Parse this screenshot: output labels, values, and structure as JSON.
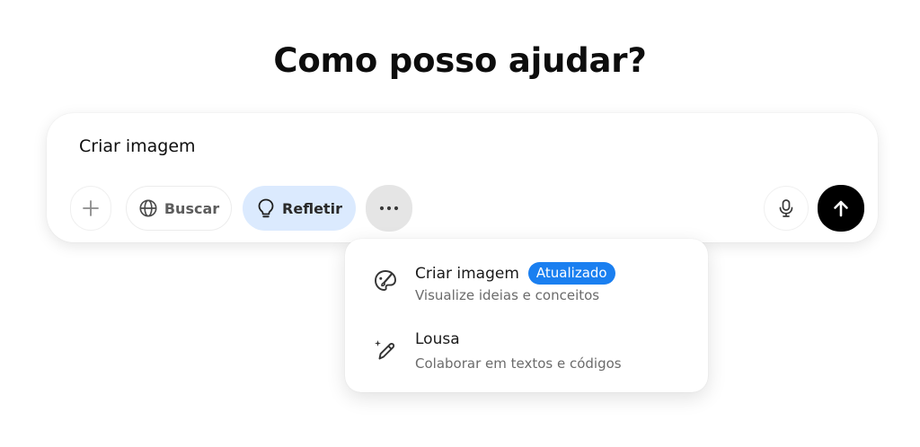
{
  "heading": "Como posso ajudar?",
  "composer": {
    "input_value": "Criar imagem",
    "search_label": "Buscar",
    "think_label": "Refletir"
  },
  "menu": {
    "items": [
      {
        "title": "Criar imagem",
        "badge": "Atualizado",
        "subtitle": "Visualize ideias e conceitos",
        "icon": "palette-brush-icon"
      },
      {
        "title": "Lousa",
        "subtitle": "Colaborar em textos e códigos",
        "icon": "pencil-sparkle-icon"
      }
    ]
  },
  "colors": {
    "think_bg": "#dbeafe",
    "badge": "#1a7ff0",
    "send_bg": "#000000"
  }
}
